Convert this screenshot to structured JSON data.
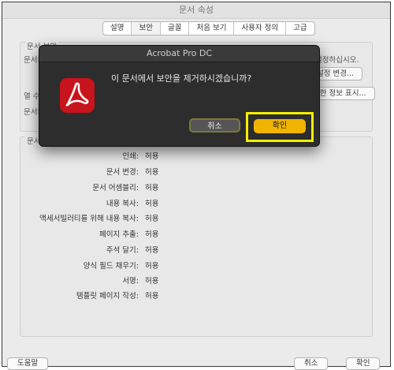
{
  "window": {
    "title": "문서 속성"
  },
  "tabs": [
    "설명",
    "보안",
    "글꼴",
    "처음 보기",
    "사용자 정의",
    "고급"
  ],
  "security_panel": {
    "title": "문서 보안",
    "row1_label": "문서의",
    "row1_right": "설정하십시오.",
    "settings_button": "설정 변경...",
    "row2_label": "열 수",
    "details_button": "세한 정보 표시...",
    "row3_label": "문서의"
  },
  "summary_panel": {
    "title": "문서 제",
    "permissions": [
      {
        "label": "인쇄:",
        "value": "허용"
      },
      {
        "label": "문서 변경:",
        "value": "허용"
      },
      {
        "label": "문서 어셈블리:",
        "value": "허용"
      },
      {
        "label": "내용 복사:",
        "value": "허용"
      },
      {
        "label": "액세서빌러티를 위해 내용 복사:",
        "value": "허용"
      },
      {
        "label": "페이지 추출:",
        "value": "허용"
      },
      {
        "label": "주석 달기:",
        "value": "허용"
      },
      {
        "label": "양식 필드 채우기:",
        "value": "허용"
      },
      {
        "label": "서명:",
        "value": "허용"
      },
      {
        "label": "템플릿 페이지 작성:",
        "value": "허용"
      }
    ]
  },
  "footer": {
    "help": "도움말",
    "cancel": "취소",
    "ok": "확인"
  },
  "dialog": {
    "title": "Acrobat Pro DC",
    "message": "이 문서에서 보안을 제거하시겠습니까?",
    "cancel": "취소",
    "confirm": "확인",
    "highlight_color": "#f5ef00",
    "confirm_color": "#f0b400"
  },
  "icons": {
    "app": "acrobat-icon"
  }
}
